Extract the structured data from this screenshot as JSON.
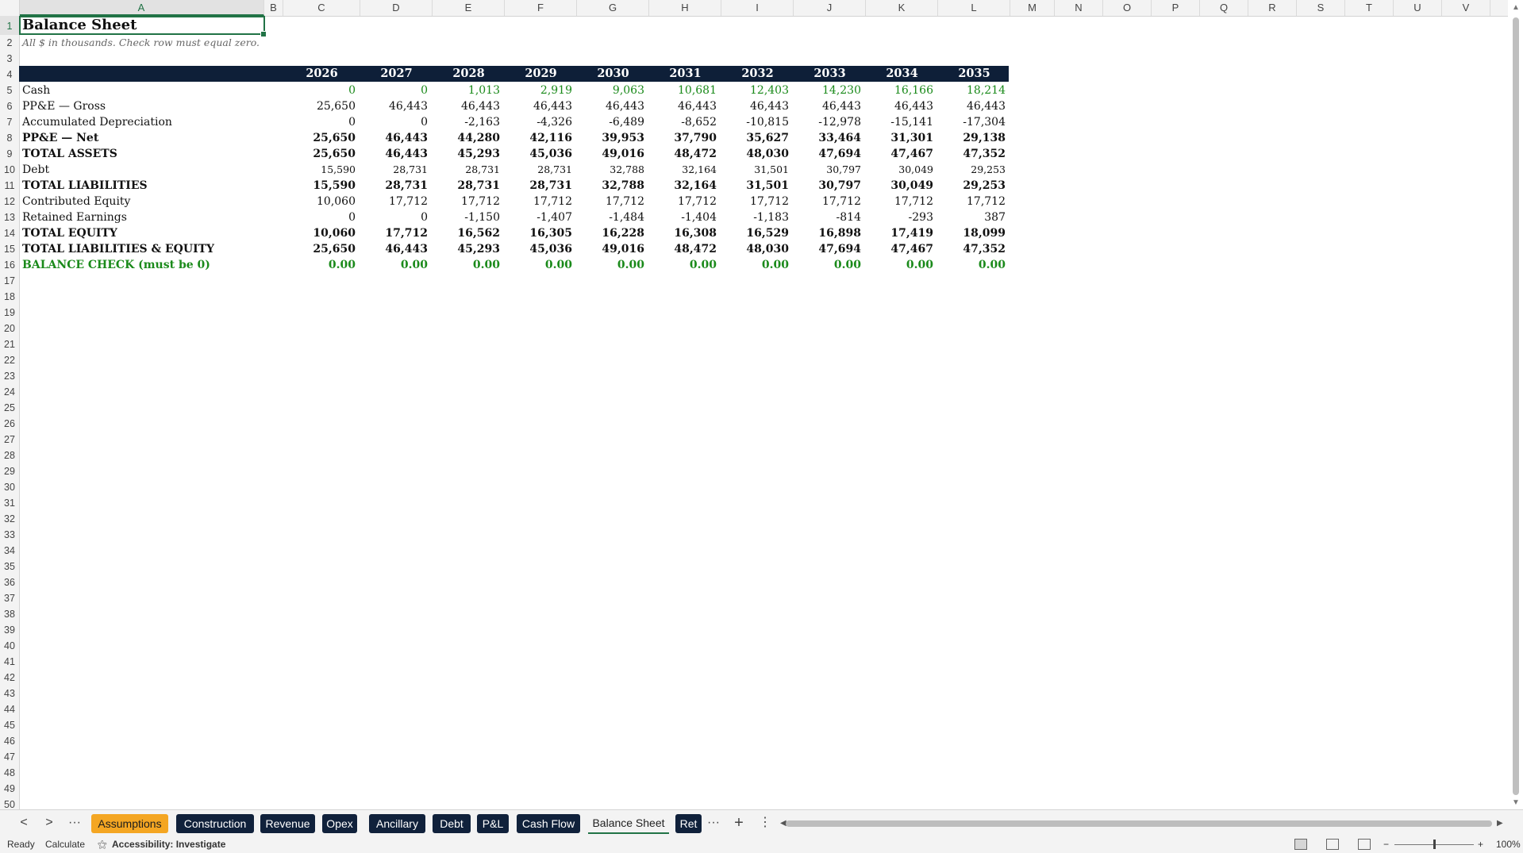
{
  "columns": [
    "A",
    "B",
    "C",
    "D",
    "E",
    "F",
    "G",
    "H",
    "I",
    "J",
    "K",
    "L",
    "M",
    "N",
    "O",
    "P",
    "Q",
    "R",
    "S",
    "T",
    "U",
    "V"
  ],
  "row_numbers": [
    "1",
    "2",
    "3",
    "4",
    "5",
    "6",
    "7",
    "8",
    "9",
    "10",
    "11",
    "12",
    "13",
    "14",
    "15",
    "16",
    "17",
    "18",
    "19",
    "20",
    "21",
    "22",
    "23",
    "24",
    "25",
    "26",
    "27",
    "28",
    "29",
    "30",
    "31",
    "32",
    "33",
    "34",
    "35",
    "36",
    "37",
    "38",
    "39",
    "40",
    "41",
    "42",
    "43",
    "44",
    "45",
    "46",
    "47",
    "48",
    "49",
    "50"
  ],
  "sheet": {
    "title": "Balance Sheet",
    "subtitle": "All $ in thousands. Check row must equal zero.",
    "years": [
      "2026",
      "2027",
      "2028",
      "2029",
      "2030",
      "2031",
      "2032",
      "2033",
      "2034",
      "2035"
    ],
    "rows": [
      {
        "label": "Cash",
        "values": [
          "0",
          "0",
          "1,013",
          "2,919",
          "9,063",
          "10,681",
          "12,403",
          "14,230",
          "16,166",
          "18,214"
        ],
        "style": "green"
      },
      {
        "label": "PP&E — Gross",
        "values": [
          "25,650",
          "46,443",
          "46,443",
          "46,443",
          "46,443",
          "46,443",
          "46,443",
          "46,443",
          "46,443",
          "46,443"
        ],
        "style": "normal"
      },
      {
        "label": "Accumulated Depreciation",
        "values": [
          "0",
          "0",
          "-2,163",
          "-4,326",
          "-6,489",
          "-8,652",
          "-10,815",
          "-12,978",
          "-15,141",
          "-17,304"
        ],
        "style": "normal"
      },
      {
        "label": "PP&E — Net",
        "values": [
          "25,650",
          "46,443",
          "44,280",
          "42,116",
          "39,953",
          "37,790",
          "35,627",
          "33,464",
          "31,301",
          "29,138"
        ],
        "style": "bold"
      },
      {
        "label": "TOTAL ASSETS",
        "values": [
          "25,650",
          "46,443",
          "45,293",
          "45,036",
          "49,016",
          "48,472",
          "48,030",
          "47,694",
          "47,467",
          "47,352"
        ],
        "style": "bold"
      },
      {
        "label": "Debt",
        "values": [
          "15,590",
          "28,731",
          "28,731",
          "28,731",
          "32,788",
          "32,164",
          "31,501",
          "30,797",
          "30,049",
          "29,253"
        ],
        "style": "small"
      },
      {
        "label": "TOTAL LIABILITIES",
        "values": [
          "15,590",
          "28,731",
          "28,731",
          "28,731",
          "32,788",
          "32,164",
          "31,501",
          "30,797",
          "30,049",
          "29,253"
        ],
        "style": "bold"
      },
      {
        "label": "Contributed Equity",
        "values": [
          "10,060",
          "17,712",
          "17,712",
          "17,712",
          "17,712",
          "17,712",
          "17,712",
          "17,712",
          "17,712",
          "17,712"
        ],
        "style": "normal"
      },
      {
        "label": "Retained Earnings",
        "values": [
          "0",
          "0",
          "-1,150",
          "-1,407",
          "-1,484",
          "-1,404",
          "-1,183",
          "-814",
          "-293",
          "387"
        ],
        "style": "normal"
      },
      {
        "label": "TOTAL EQUITY",
        "values": [
          "10,060",
          "17,712",
          "16,562",
          "16,305",
          "16,228",
          "16,308",
          "16,529",
          "16,898",
          "17,419",
          "18,099"
        ],
        "style": "bold"
      },
      {
        "label": "TOTAL LIABILITIES & EQUITY",
        "values": [
          "25,650",
          "46,443",
          "45,293",
          "45,036",
          "49,016",
          "48,472",
          "48,030",
          "47,694",
          "47,467",
          "47,352"
        ],
        "style": "bold"
      },
      {
        "label": "BALANCE CHECK (must be 0)",
        "values": [
          "0.00",
          "0.00",
          "0.00",
          "0.00",
          "0.00",
          "0.00",
          "0.00",
          "0.00",
          "0.00",
          "0.00"
        ],
        "style": "boldgreen"
      }
    ]
  },
  "tabs": [
    {
      "label": "Assumptions",
      "kind": "orange"
    },
    {
      "label": "Construction",
      "kind": "dark"
    },
    {
      "label": "Revenue",
      "kind": "dark"
    },
    {
      "label": "Opex",
      "kind": "dark"
    },
    {
      "label": "Ancillary",
      "kind": "dark"
    },
    {
      "label": "Debt",
      "kind": "dark"
    },
    {
      "label": "P&L",
      "kind": "dark"
    },
    {
      "label": "Cash Flow",
      "kind": "dark"
    },
    {
      "label": "Balance Sheet",
      "kind": "active"
    },
    {
      "label": "Ret",
      "kind": "dark"
    }
  ],
  "tabs_nav": {
    "prev": "<",
    "next": ">",
    "more_left": "···",
    "more_right": "···",
    "add": "+",
    "options": "⋮"
  },
  "status": {
    "ready": "Ready",
    "calculate": "Calculate",
    "accessibility": "Accessibility: Investigate",
    "zoom": "100%",
    "zoom_minus": "−",
    "zoom_plus": "+"
  },
  "colors": {
    "header_band": "#0e1f38",
    "accent_green": "#1a8a1a",
    "tab_dark": "#10213b",
    "tab_orange": "#f4a623",
    "selection": "#217346"
  }
}
